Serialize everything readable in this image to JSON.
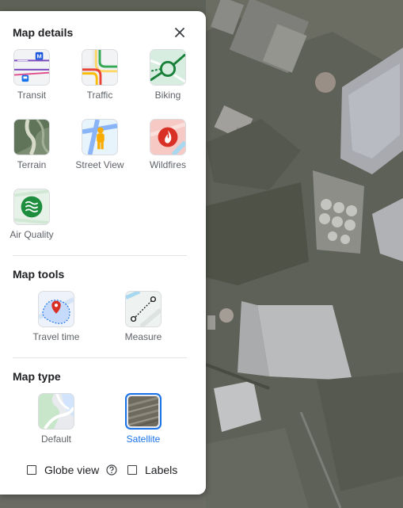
{
  "panel": {
    "close_icon": "close-icon",
    "map_details": {
      "title": "Map details",
      "items": [
        {
          "label": "Transit",
          "icon": "transit-thumbnail"
        },
        {
          "label": "Traffic",
          "icon": "traffic-thumbnail"
        },
        {
          "label": "Biking",
          "icon": "biking-thumbnail"
        },
        {
          "label": "Terrain",
          "icon": "terrain-thumbnail"
        },
        {
          "label": "Street View",
          "icon": "street-view-thumbnail"
        },
        {
          "label": "Wildfires",
          "icon": "wildfires-thumbnail"
        },
        {
          "label": "Air Quality",
          "icon": "air-quality-thumbnail"
        }
      ]
    },
    "map_tools": {
      "title": "Map tools",
      "items": [
        {
          "label": "Travel time",
          "icon": "travel-time-thumbnail"
        },
        {
          "label": "Measure",
          "icon": "measure-thumbnail"
        }
      ]
    },
    "map_type": {
      "title": "Map type",
      "items": [
        {
          "label": "Default",
          "icon": "default-map-thumbnail"
        },
        {
          "label": "Satellite",
          "icon": "satellite-thumbnail",
          "selected": true
        }
      ]
    },
    "options": {
      "globe_view": {
        "label": "Globe view",
        "checked": false
      },
      "labels": {
        "label": "Labels",
        "checked": false
      }
    }
  },
  "colors": {
    "accent": "#1a73e8",
    "title_text": "#202124",
    "label_text": "#5f6368"
  }
}
